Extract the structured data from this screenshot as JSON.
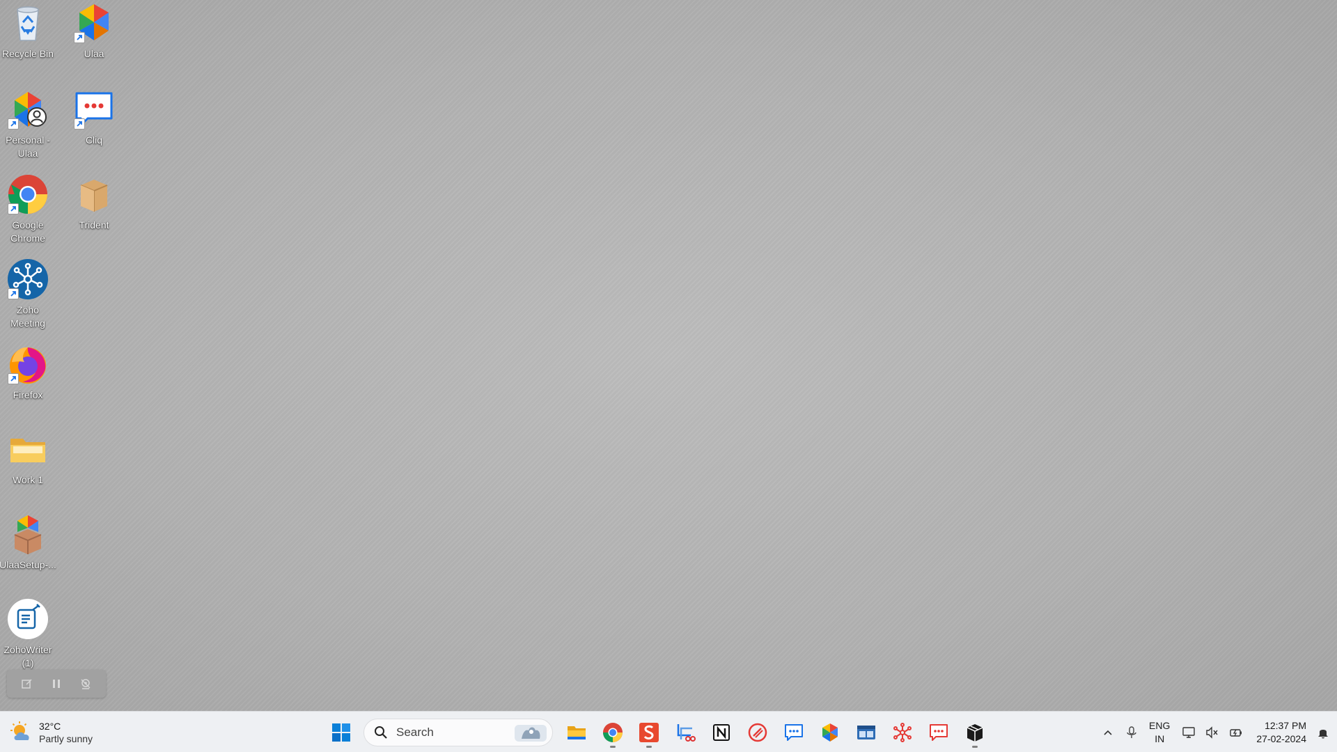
{
  "desktop": {
    "icons": [
      {
        "label": "Recycle Bin",
        "icon": "recycle-bin-icon"
      },
      {
        "label": "Ulaa",
        "icon": "ulaa-icon"
      },
      {
        "label": "Personal -\nUlaa",
        "icon": "ulaa-personal-icon"
      },
      {
        "label": "Cliq",
        "icon": "cliq-icon"
      },
      {
        "label": "Google\nChrome",
        "icon": "chrome-icon"
      },
      {
        "label": "Trident",
        "icon": "box-icon"
      },
      {
        "label": "Zoho\nMeeting",
        "icon": "zoho-meeting-icon"
      },
      {
        "label": "Firefox",
        "icon": "firefox-icon"
      },
      {
        "label": "Work 1",
        "icon": "folder-icon"
      },
      {
        "label": "UlaaSetup-...",
        "icon": "installer-icon"
      },
      {
        "label": "ZohoWriter\n(1)",
        "icon": "zoho-writer-icon"
      }
    ]
  },
  "recorder": {
    "buttons": [
      "edit-icon",
      "pause-icon",
      "webcam-icon"
    ]
  },
  "taskbar": {
    "weather": {
      "temp": "32°C",
      "condition": "Partly sunny",
      "icon": "sun-cloud-icon"
    },
    "search": {
      "placeholder": "Search"
    },
    "apps": [
      "windows-start-icon",
      "file-explorer-icon",
      "chrome-icon",
      "sublime-icon",
      "snipping-tool-icon",
      "notion-icon",
      "no-symbol-icon",
      "cliq-icon",
      "ulaa-icon",
      "window-manager-icon",
      "zoho-meeting-icon",
      "cliq-chat-icon",
      "box-icon"
    ],
    "tray": {
      "language_top": "ENG",
      "language_bottom": "IN",
      "time": "12:37 PM",
      "date": "27-02-2024"
    }
  },
  "colors": {
    "taskbar_bg": "#eef0f3",
    "desktop_bg": "#b4b4b4",
    "accent_blue": "#0067c0"
  }
}
